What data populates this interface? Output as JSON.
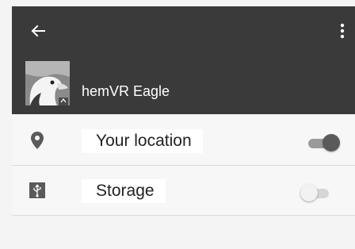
{
  "header": {
    "app_name": "hemVR Eagle",
    "back_icon": "arrow-back-icon",
    "menu_icon": "more-vertical-icon",
    "app_icon": "eagle-app-icon"
  },
  "permissions": [
    {
      "label": "Your location",
      "icon": "location-pin-icon",
      "enabled": true
    },
    {
      "label": "Storage",
      "icon": "usb-storage-icon",
      "enabled": false
    }
  ],
  "colors": {
    "app_bar": "#3a3a3a",
    "background": "#f4f4f4",
    "toggle_on_knob": "#5a5a5a",
    "toggle_off_knob": "#f2f2f2"
  }
}
